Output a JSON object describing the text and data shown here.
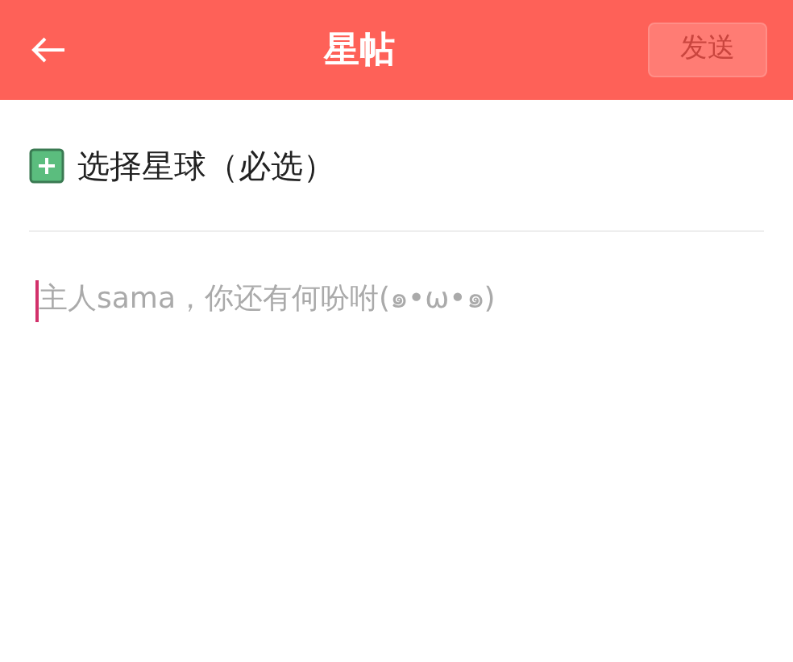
{
  "header": {
    "title": "星帖",
    "send_button": {
      "label": "发送",
      "disabled": true
    }
  },
  "planet_picker": {
    "label": "选择星球（必选）"
  },
  "editor": {
    "placeholder": "主人sama，你还有何吩咐(๑•ω•๑)"
  }
}
